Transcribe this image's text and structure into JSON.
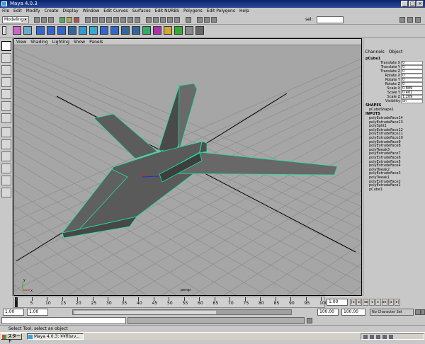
{
  "window": {
    "title": "Maya 4.0.3"
  },
  "menus": [
    "File",
    "Edit",
    "Modify",
    "Create",
    "Display",
    "Window",
    "Edit Curves",
    "Surfaces",
    "Edit NURBS",
    "Polygons",
    "Edit Polygons",
    "Help"
  ],
  "status_line": {
    "mode": "Modeling",
    "sel_label": "sel:",
    "sel_value": ""
  },
  "viewport": {
    "menus": [
      "View",
      "Shading",
      "Lighting",
      "Show",
      "Panels"
    ],
    "camera": "persp",
    "axis_labels": {
      "x": "x",
      "y": "y"
    },
    "colors": {
      "background": "#a6a6a6",
      "grid": "#8c8c8c",
      "wire": "#19e6a0"
    }
  },
  "channel_box": {
    "tabs": [
      "Channels",
      "Object"
    ],
    "object": "pCube1",
    "attributes": [
      {
        "label": "Translate X",
        "value": "0"
      },
      {
        "label": "Translate Y",
        "value": "0"
      },
      {
        "label": "Translate Z",
        "value": "0"
      },
      {
        "label": "Rotate X",
        "value": "0"
      },
      {
        "label": "Rotate Y",
        "value": "0"
      },
      {
        "label": "Rotate Z",
        "value": "0"
      },
      {
        "label": "Scale X",
        "value": "0.889"
      },
      {
        "label": "Scale Y",
        "value": "0.401"
      },
      {
        "label": "Scale Z",
        "value": "1.209"
      },
      {
        "label": "Visibility",
        "value": "on"
      }
    ],
    "shapes_label": "SHAPES",
    "shape": "pCubeShape1",
    "inputs_label": "INPUTS",
    "inputs": [
      "polyExtrudeFace14",
      "polyExtrudeFace13",
      "polySplit1",
      "polyExtrudeFace12",
      "polyExtrudeFace11",
      "polyExtrudeFace10",
      "polyExtrudeFace9",
      "polyExtrudeFace8",
      "polyTweak3",
      "polyExtrudeFace7",
      "polyExtrudeFace6",
      "polyExtrudeFace5",
      "polyExtrudeFace4",
      "polyTweak2",
      "polyExtrudeFace3",
      "polyTweak1",
      "polyExtrudeFace2",
      "polyExtrudeFace1",
      "pCube1"
    ]
  },
  "time_slider": {
    "tick_labels": [
      "1",
      "5",
      "10",
      "15",
      "20",
      "25",
      "30",
      "35",
      "40",
      "45",
      "50",
      "55",
      "60",
      "65",
      "70",
      "75",
      "80",
      "85",
      "90",
      "95",
      "100"
    ],
    "current_frame": "1.00"
  },
  "range_slider": {
    "start": "1.00",
    "anim_start": "1.00",
    "end": "100.00",
    "anim_end": "100.00",
    "character": "No Character Set"
  },
  "help_line": "Select Tool: select an object",
  "taskbar": {
    "start": "スタート",
    "task": "Maya 4.0.3: ¥¥filsrv..."
  }
}
